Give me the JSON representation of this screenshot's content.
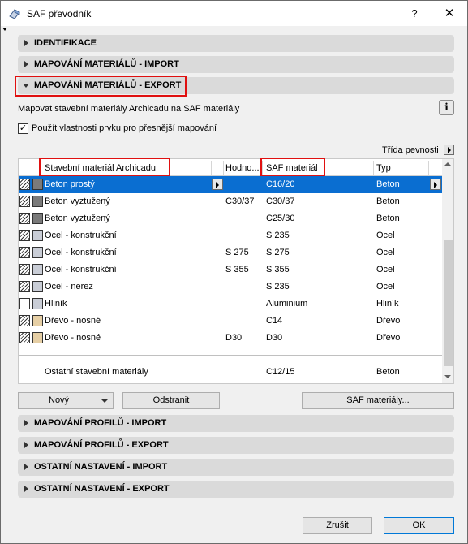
{
  "window": {
    "title": "SAF převodník",
    "help": "?",
    "close": "✕"
  },
  "sections_top": [
    {
      "label": "IDENTIFIKACE",
      "expanded": false
    },
    {
      "label": "MAPOVÁNÍ MATERIÁLŮ - IMPORT",
      "expanded": false
    },
    {
      "label": "MAPOVÁNÍ MATERIÁLŮ - EXPORT",
      "expanded": true
    }
  ],
  "export": {
    "description": "Mapovat stavební materiály Archicadu na SAF materiály",
    "info": "i",
    "use_properties_checked": true,
    "use_properties_label": "Použít vlastnosti prvku pro přesnější mapování",
    "strength_class_label": "Třída pevnosti"
  },
  "table": {
    "headers": {
      "material": "Stavební materiál Archicadu",
      "value": "Hodno...",
      "saf": "SAF materiál",
      "type": "Typ"
    },
    "rows": [
      {
        "name": "Beton prostý",
        "value": "",
        "saf": "C16/20",
        "type": "Beton",
        "hatch": true,
        "color": "#7a7a7a",
        "selected": true
      },
      {
        "name": "Beton vyztužený",
        "value": "C30/37",
        "saf": "C30/37",
        "type": "Beton",
        "hatch": true,
        "color": "#7a7a7a",
        "selected": false
      },
      {
        "name": "Beton vyztužený",
        "value": "",
        "saf": "C25/30",
        "type": "Beton",
        "hatch": true,
        "color": "#7a7a7a",
        "selected": false
      },
      {
        "name": "Ocel - konstrukční",
        "value": "",
        "saf": "S 235",
        "type": "Ocel",
        "hatch": true,
        "color": "#c9cdd6",
        "selected": false
      },
      {
        "name": "Ocel - konstrukční",
        "value": "S 275",
        "saf": "S 275",
        "type": "Ocel",
        "hatch": true,
        "color": "#c9cdd6",
        "selected": false
      },
      {
        "name": "Ocel - konstrukční",
        "value": "S 355",
        "saf": "S 355",
        "type": "Ocel",
        "hatch": true,
        "color": "#c9cdd6",
        "selected": false
      },
      {
        "name": "Ocel - nerez",
        "value": "",
        "saf": "S 235",
        "type": "Ocel",
        "hatch": true,
        "color": "#c9cdd6",
        "selected": false
      },
      {
        "name": "Hliník",
        "value": "",
        "saf": "Aluminium",
        "type": "Hliník",
        "hatch": false,
        "color": "#c9cdd6",
        "selected": false
      },
      {
        "name": "Dřevo - nosné",
        "value": "",
        "saf": "C14",
        "type": "Dřevo",
        "hatch": true,
        "color": "#e6cfa5",
        "selected": false
      },
      {
        "name": "Dřevo - nosné",
        "value": "D30",
        "saf": "D30",
        "type": "Dřevo",
        "hatch": true,
        "color": "#e6cfa5",
        "selected": false
      }
    ],
    "other": {
      "name": "Ostatní stavební materiály",
      "saf": "C12/15",
      "type": "Beton"
    }
  },
  "buttons": {
    "new": "Nový",
    "delete": "Odstranit",
    "saf_materials": "SAF materiály..."
  },
  "sections_bottom": [
    {
      "label": "MAPOVÁNÍ PROFILŮ - IMPORT"
    },
    {
      "label": "MAPOVÁNÍ PROFILŮ - EXPORT"
    },
    {
      "label": "OSTATNÍ NASTAVENÍ - IMPORT"
    },
    {
      "label": "OSTATNÍ NASTAVENÍ - EXPORT"
    }
  ],
  "footer": {
    "cancel": "Zrušit",
    "ok": "OK"
  },
  "colors": {
    "selection": "#0a6ed1",
    "highlight_box": "#e01010",
    "section_bg": "#dadada"
  }
}
